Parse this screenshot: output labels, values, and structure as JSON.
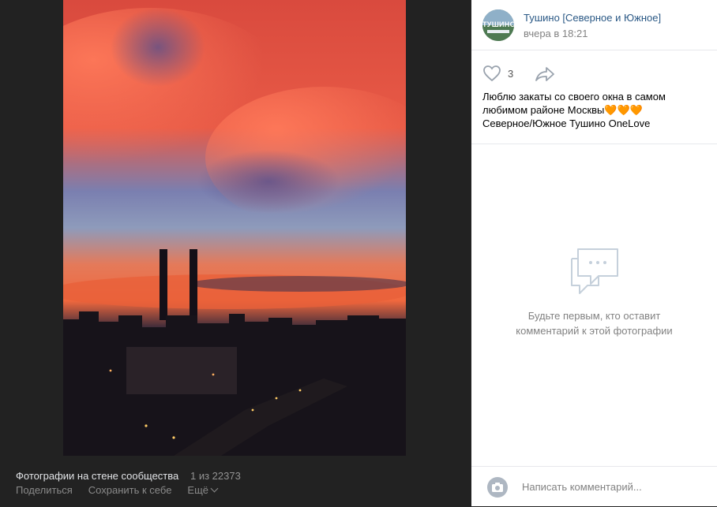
{
  "viewer": {
    "album_title": "Фотографии на стене сообщества",
    "counter": "1 из 22373",
    "actions": {
      "share": "Поделиться",
      "save": "Сохранить к себе",
      "more": "Ещё"
    }
  },
  "post": {
    "author": "Тушино [Северное и Южное]",
    "avatar_text": "ТУШИНО",
    "time": "вчера в 18:21",
    "likes": "3",
    "caption_line1": "Люблю закаты со своего окна в самом",
    "caption_line2": "любимом районе Москвы",
    "caption_hearts": "🧡🧡🧡",
    "caption_line3": "Северное/Южное Тушино OneLove"
  },
  "comments": {
    "empty_line1": "Будьте первым, кто оставит",
    "empty_line2": "комментарий к этой фотографии",
    "input_placeholder": "Написать комментарий..."
  },
  "colors": {
    "link": "#2a5885",
    "muted": "#828282",
    "viewer_bg": "#222222"
  }
}
